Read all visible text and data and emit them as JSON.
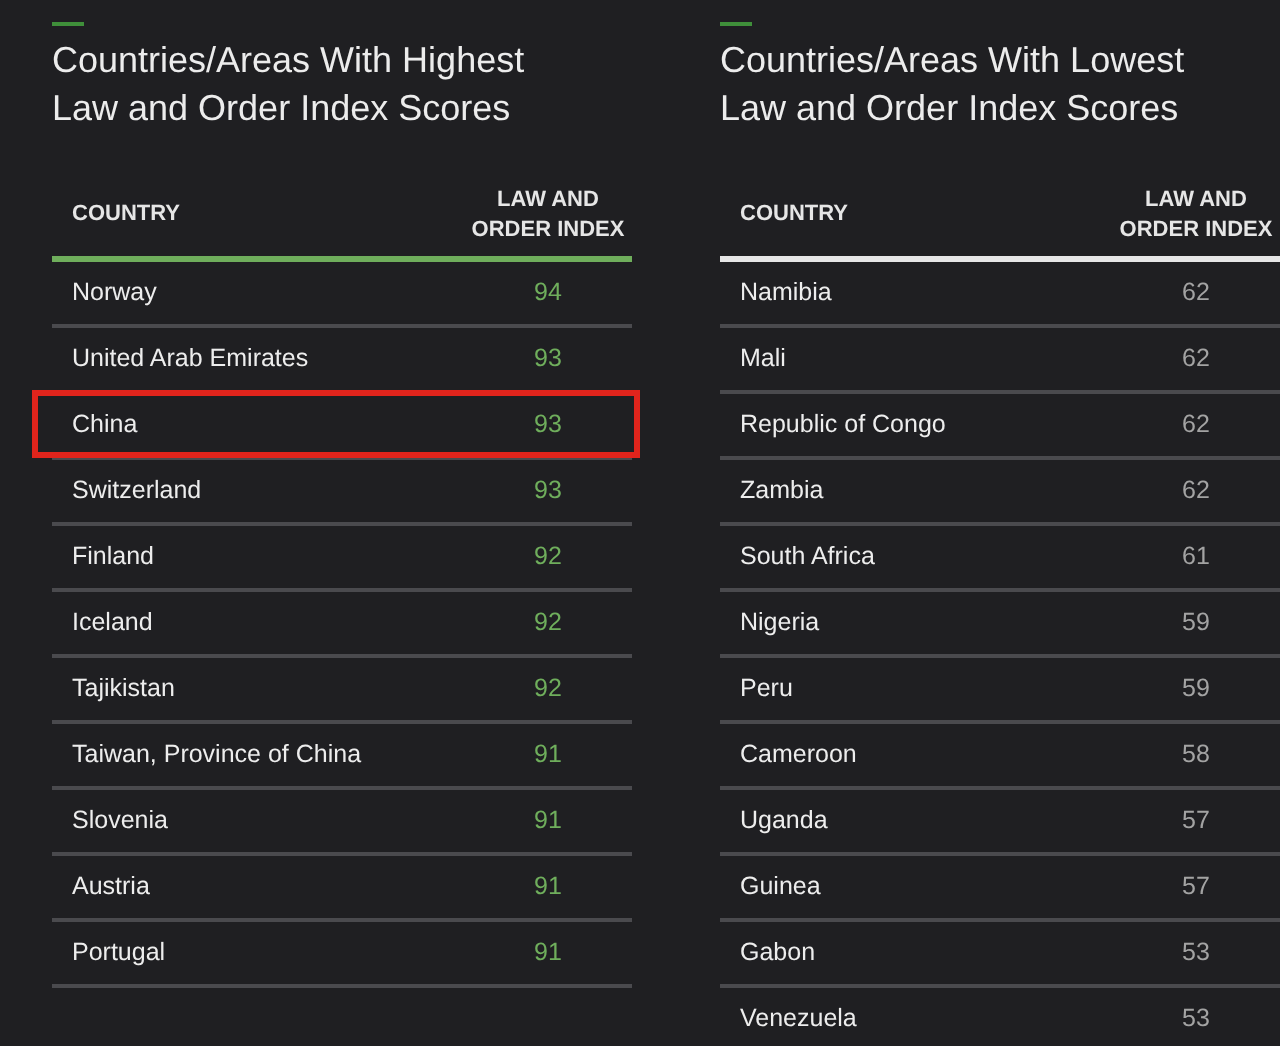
{
  "tables": [
    {
      "title": "Countries/Areas With Highest Law and Order Index Scores",
      "color": "#6fae5c",
      "columns": [
        "COUNTRY",
        "LAW AND ORDER INDEX"
      ],
      "rows": [
        {
          "country": "Norway",
          "index": "94",
          "highlighted": false
        },
        {
          "country": "United Arab Emirates",
          "index": "93",
          "highlighted": false
        },
        {
          "country": "China",
          "index": "93",
          "highlighted": true
        },
        {
          "country": "Switzerland",
          "index": "93",
          "highlighted": false
        },
        {
          "country": "Finland",
          "index": "92",
          "highlighted": false
        },
        {
          "country": "Iceland",
          "index": "92",
          "highlighted": false
        },
        {
          "country": "Tajikistan",
          "index": "92",
          "highlighted": false
        },
        {
          "country": "Taiwan, Province of China",
          "index": "91",
          "highlighted": false
        },
        {
          "country": "Slovenia",
          "index": "91",
          "highlighted": false
        },
        {
          "country": "Austria",
          "index": "91",
          "highlighted": false
        },
        {
          "country": "Portugal",
          "index": "91",
          "highlighted": false
        }
      ]
    },
    {
      "title": "Countries/Areas With Lowest Law and Order Index Scores",
      "color": "#e6e6e6",
      "columns": [
        "COUNTRY",
        "LAW AND ORDER INDEX"
      ],
      "rows": [
        {
          "country": "Namibia",
          "index": "62",
          "highlighted": false
        },
        {
          "country": "Mali",
          "index": "62",
          "highlighted": false
        },
        {
          "country": "Republic of Congo",
          "index": "62",
          "highlighted": false
        },
        {
          "country": "Zambia",
          "index": "62",
          "highlighted": false
        },
        {
          "country": "South Africa",
          "index": "61",
          "highlighted": false
        },
        {
          "country": "Nigeria",
          "index": "59",
          "highlighted": false
        },
        {
          "country": "Peru",
          "index": "59",
          "highlighted": false
        },
        {
          "country": "Cameroon",
          "index": "58",
          "highlighted": false
        },
        {
          "country": "Uganda",
          "index": "57",
          "highlighted": false
        },
        {
          "country": "Guinea",
          "index": "57",
          "highlighted": false
        },
        {
          "country": "Gabon",
          "index": "53",
          "highlighted": false
        },
        {
          "country": "Venezuela",
          "index": "53",
          "highlighted": false
        }
      ]
    }
  ]
}
